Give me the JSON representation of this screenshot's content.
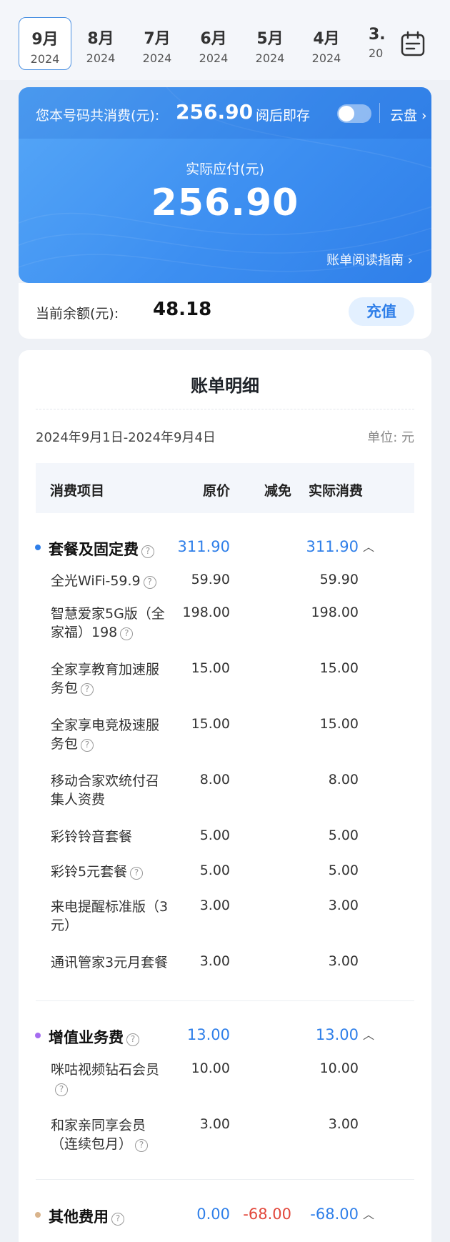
{
  "months": [
    {
      "month": "9月",
      "year": "2024"
    },
    {
      "month": "8月",
      "year": "2024"
    },
    {
      "month": "7月",
      "year": "2024"
    },
    {
      "month": "6月",
      "year": "2024"
    },
    {
      "month": "5月",
      "year": "2024"
    },
    {
      "month": "4月",
      "year": "2024"
    },
    {
      "month": "3.",
      "year": "20"
    }
  ],
  "summary": {
    "total_label": "您本号码共消费(元):",
    "total_value": "256.90",
    "read_save_label": "阅后即存",
    "cloud_link": "云盘 ›",
    "pay_label": "实际应付(元)",
    "pay_value": "256.90",
    "guide_link": "账单阅读指南 ›"
  },
  "balance": {
    "label": "当前余额(元):",
    "value": "48.18",
    "recharge_label": "充值"
  },
  "bill": {
    "title": "账单明细",
    "period": "2024年9月1日-2024年9月4日",
    "unit": "单位: 元",
    "headers": {
      "item": "消费项目",
      "original": "原价",
      "discount": "减免",
      "actual": "实际消费"
    },
    "sections": {
      "package": {
        "title": "套餐及固定费",
        "original": "311.90",
        "actual": "311.90"
      },
      "vas": {
        "title": "增值业务费",
        "original": "13.00",
        "actual": "13.00"
      },
      "other": {
        "title": "其他费用",
        "original": "0.00",
        "discount": "-68.00",
        "actual": "-68.00"
      }
    },
    "package_items": [
      {
        "line1": "全光WiFi-59.9",
        "line2": "",
        "original": "59.90",
        "actual": "59.90"
      },
      {
        "line1": "智慧爱家5G版（全",
        "line2": "家福）198",
        "original": "198.00",
        "actual": "198.00"
      },
      {
        "line1": "全家享教育加速服",
        "line2": "务包",
        "original": "15.00",
        "actual": "15.00"
      },
      {
        "line1": "全家享电竞极速服",
        "line2": "务包",
        "original": "15.00",
        "actual": "15.00"
      },
      {
        "line1": "移动合家欢统付召",
        "line2": "集人资费",
        "original": "8.00",
        "actual": "8.00"
      },
      {
        "line1": "彩铃铃音套餐",
        "line2": "",
        "original": "5.00",
        "actual": "5.00"
      },
      {
        "line1": "彩铃5元套餐",
        "line2": "",
        "original": "5.00",
        "actual": "5.00"
      },
      {
        "line1": "来电提醒标准版（3",
        "line2": "元）",
        "original": "3.00",
        "actual": "3.00"
      },
      {
        "line1": "通讯管家3元月套餐",
        "line2": "",
        "original": "3.00",
        "actual": "3.00"
      }
    ],
    "vas_items": [
      {
        "line1": "咪咕视频钻石会员",
        "line2": "",
        "original": "10.00",
        "actual": "10.00"
      },
      {
        "line1": "和家亲同享会员",
        "line2": "（连续包月）",
        "original": "3.00",
        "actual": "3.00"
      }
    ]
  },
  "colors": {
    "accent": "#2f7fe9",
    "negative": "#e2483c",
    "card_blue": "#3d8ff1"
  }
}
